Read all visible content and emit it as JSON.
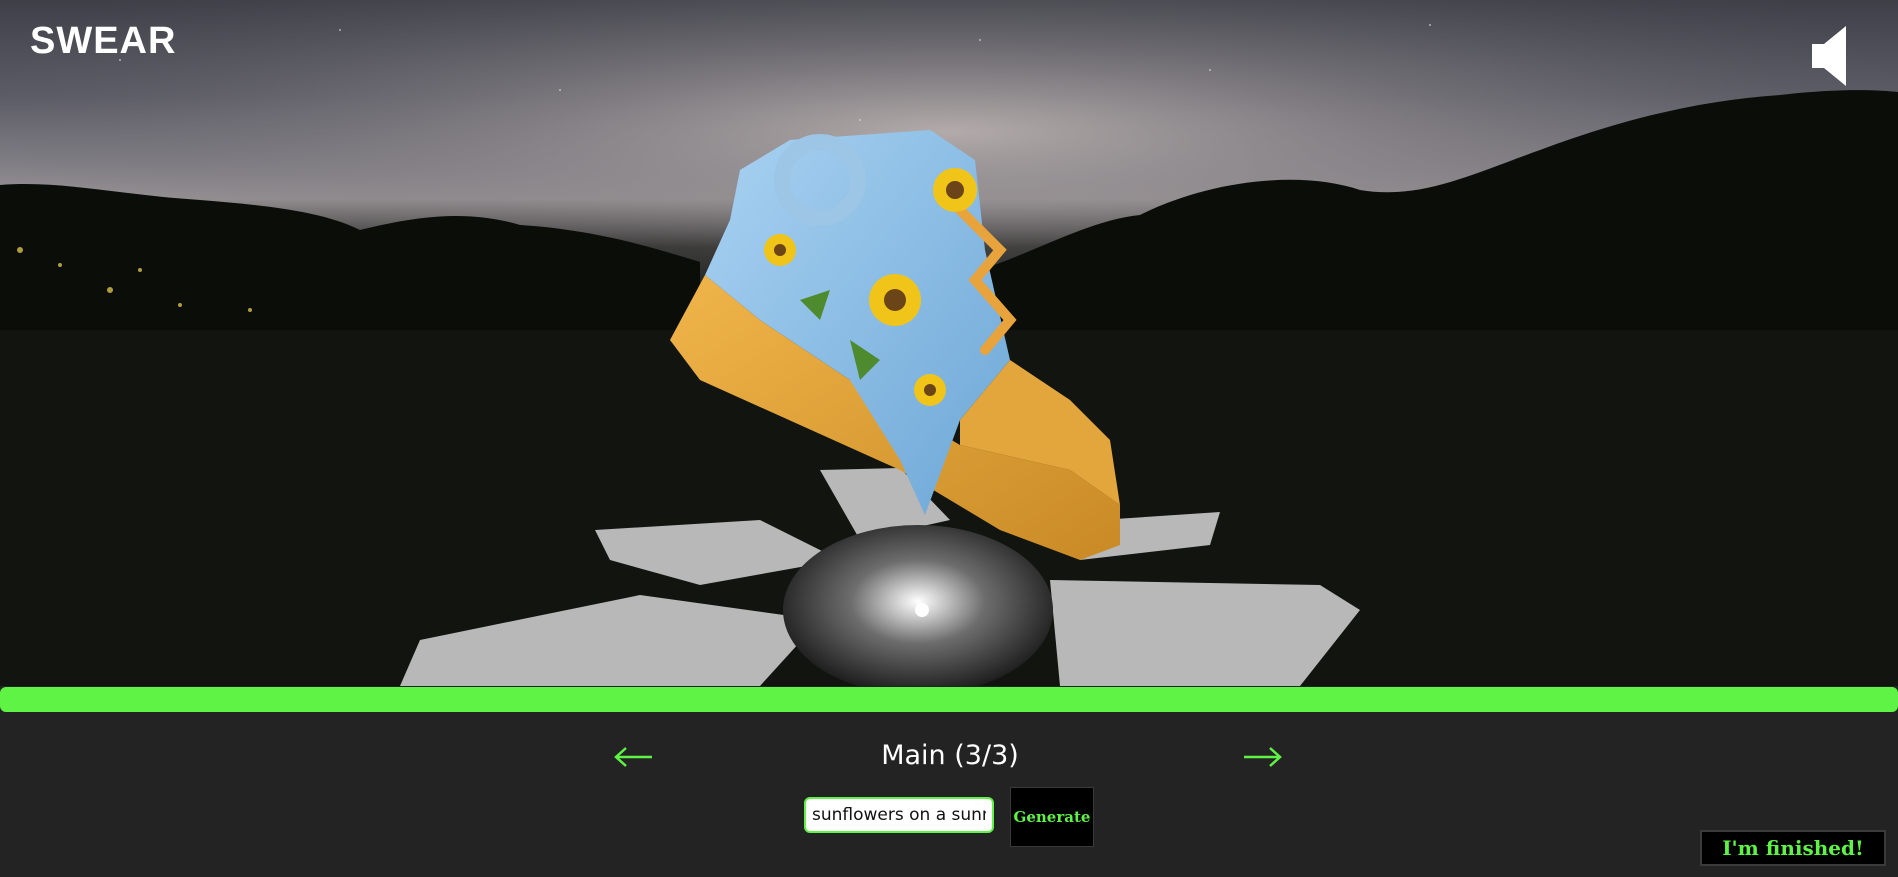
{
  "app": {
    "brand": "SWEAR"
  },
  "viewer": {
    "sound_icon": "speaker-icon",
    "progress_fraction": 1.0,
    "progress_color": "#5ff346"
  },
  "navigation": {
    "prev_icon": "arrow-left-icon",
    "next_icon": "arrow-right-icon",
    "title": "Main (3/3)"
  },
  "prompt": {
    "value": "sunflowers on a sunny day",
    "generate_label": "Generate"
  },
  "footer": {
    "finish_label": "I'm finished!"
  },
  "colors": {
    "accent": "#5ff346",
    "panel_bg": "#232323",
    "sole": "#e0a33a",
    "upper": "#8fbfe6"
  }
}
